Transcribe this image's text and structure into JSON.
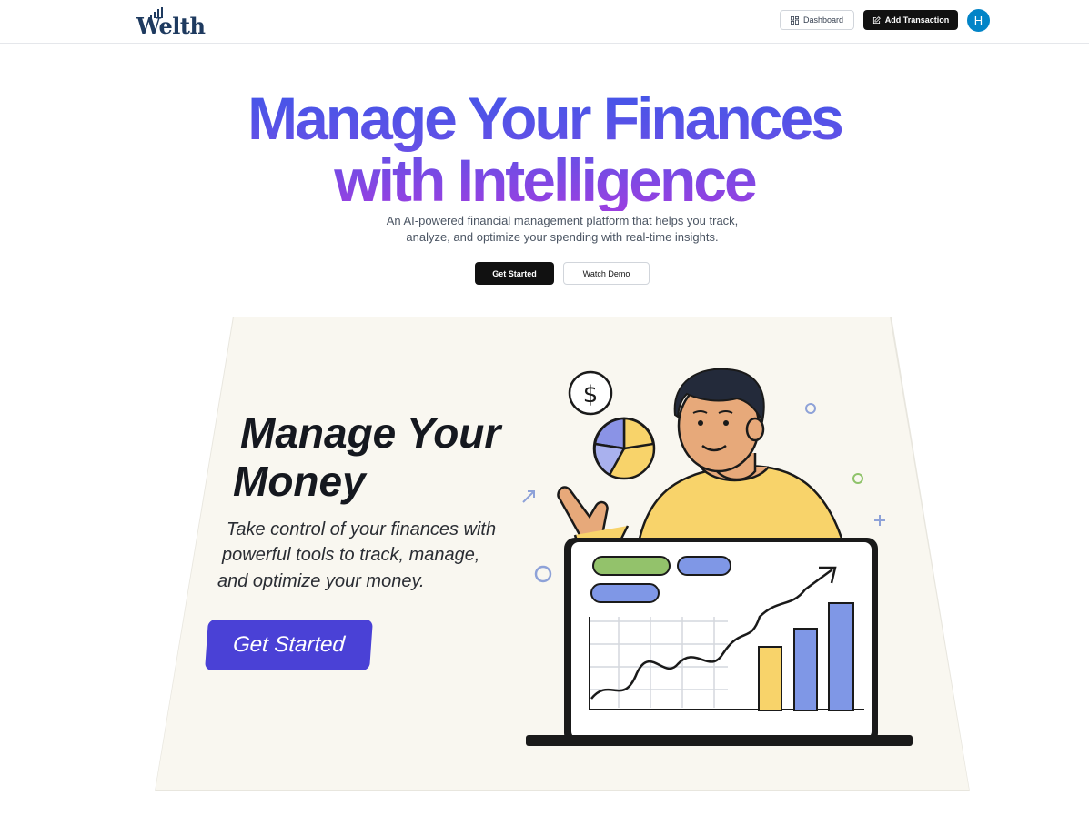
{
  "header": {
    "logo_text": "Welth",
    "dashboard_label": "Dashboard",
    "add_transaction_label": "Add Transaction",
    "avatar_initial": "H"
  },
  "hero": {
    "title_line1": "Manage Your Finances",
    "title_line2": "with Intelligence",
    "subtitle_line1": "An AI-powered financial management platform that helps you track,",
    "subtitle_line2": "analyze, and optimize your spending with real-time insights.",
    "get_started_label": "Get Started",
    "watch_demo_label": "Watch Demo"
  },
  "illustration": {
    "title_line1": "Manage Your",
    "title_line2": "Money",
    "subtitle_line1": "Take control of your finances with",
    "subtitle_line2": "powerful tools to track, manage,",
    "subtitle_line3": "and optimize your money.",
    "button_label": "Get Started",
    "dollar_symbol": "$"
  },
  "colors": {
    "gradient_start": "#4156e8",
    "gradient_end": "#9b3fe0",
    "primary_button": "#111111",
    "avatar": "#0284c7",
    "illustration_button": "#4a41d6"
  }
}
